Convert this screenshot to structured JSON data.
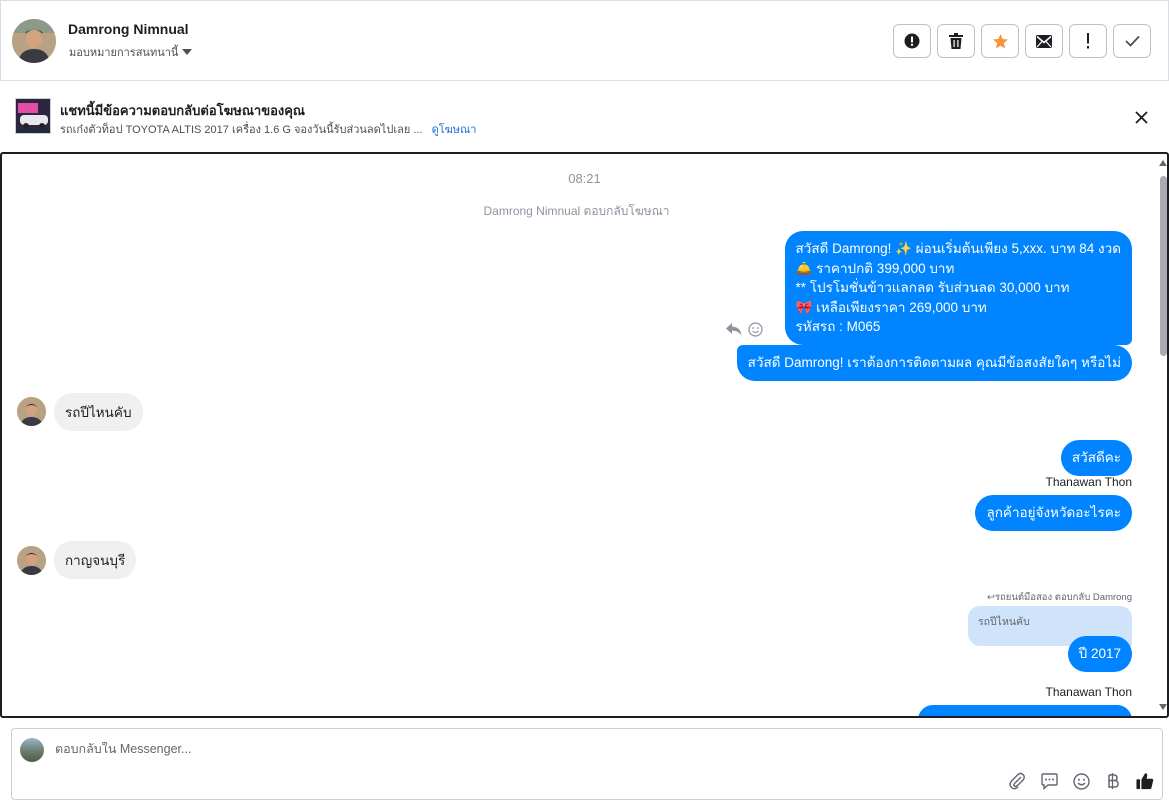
{
  "header": {
    "contact_name": "Damrong Nimnual",
    "assign_label": "มอบหมายการสนทนานี้"
  },
  "ad_banner": {
    "title": "แชทนี้มีข้อความตอบกลับต่อโฆษณาของคุณ",
    "description": "รถเก๋งตัวท็อป TOYOTA ALTIS 2017 เครื่อง 1.6 G จองวันนี้รับส่วนลดไปเลย ...",
    "link": "ดูโฆษณา"
  },
  "conversation": {
    "timestamp": "08:21",
    "system_note": "Damrong Nimnual ตอบกลับโฆษณา",
    "outgoing_long": {
      "line1": "สวัสดี Damrong! ✨  ผ่อนเริ่มต้นเพียง 5,xxx. บาท 84 งวด",
      "line2": "🛎️ ราคาปกติ 399,000 บาท",
      "line3": "** โปรโมชั่นข้าวแลกลด รับส่วนลด 30,000 บาท",
      "line4": "🎀  เหลือเพียงราคา 269,000 บาท",
      "line5": " รหัสรถ : M065"
    },
    "outgoing_followup": "สวัสดี Damrong! เราต้องการติดตามผล คุณมีข้อสงสัยใดๆ หรือไม่",
    "incoming_1": "รถปีไหนคับ",
    "outgoing_hello": "สวัสดีคะ",
    "sender_1": "Thanawan Thon",
    "outgoing_province": "ลูกค้าอยู่จังหวัดอะไรคะ",
    "incoming_2": "กาญจนบุรี",
    "reply_label": "รถยนต์มือสอง ตอบกลับ Damrong",
    "quoted_text": "รถปีไหนคับ",
    "outgoing_year": "ปี 2017",
    "sender_2": "Thanawan Thon"
  },
  "reply_box": {
    "placeholder": "ตอบกลับใน Messenger..."
  },
  "colors": {
    "bubble_out": "#0084ff",
    "bubble_in": "#f0f0f0",
    "star": "#f7923a",
    "like": "#1c1e21"
  }
}
